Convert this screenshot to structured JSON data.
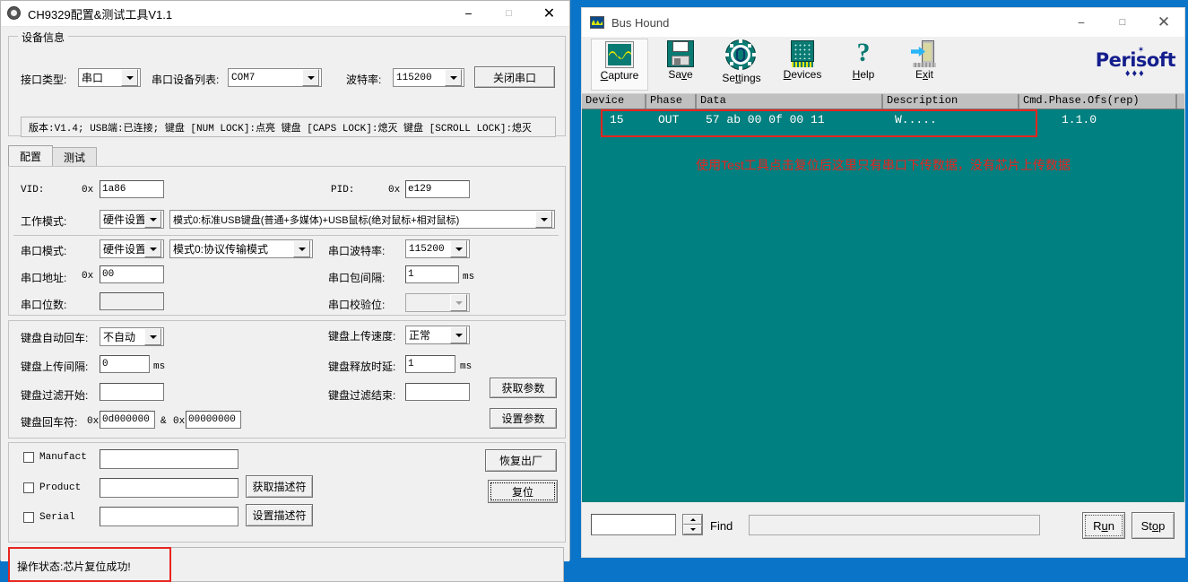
{
  "ch9329": {
    "title": "CH9329配置&测试工具V1.1",
    "titlebar": {
      "minimize": "−",
      "maximize": "□",
      "close": "✕"
    },
    "device_info": {
      "group_label": "设备信息",
      "interface_type_label": "接口类型:",
      "interface_type_value": "串口",
      "port_list_label": "串口设备列表:",
      "port_list_value": "COM7",
      "baud_label": "波特率:",
      "baud_value": "115200",
      "close_port_button": "关闭串口",
      "status_line": "版本:V1.4;  USB端:已连接;  键盘 [NUM LOCK]:点亮  键盘 [CAPS LOCK]:熄灭  键盘 [SCROLL LOCK]:熄灭"
    },
    "tabs": [
      {
        "label": "配置",
        "selected": true
      },
      {
        "label": "测试",
        "selected": false
      }
    ],
    "usb_section": {
      "vid_label": "VID:",
      "vid_prefix": "0x",
      "vid_value": "1a86",
      "pid_label": "PID:",
      "pid_prefix": "0x",
      "pid_value": "e129",
      "work_mode_label": "工作模式:",
      "work_mode_source": "硬件设置",
      "work_mode_value": "模式0:标准USB键盘(普通+多媒体)+USB鼠标(绝对鼠标+相对鼠标)"
    },
    "serial_section": {
      "serial_mode_label": "串口模式:",
      "serial_mode_source": "硬件设置",
      "serial_mode_value": "模式0:协议传输模式",
      "serial_baud_label": "串口波特率:",
      "serial_baud_value": "115200",
      "serial_addr_label": "串口地址:",
      "serial_addr_prefix": "0x",
      "serial_addr_value": "00",
      "packet_interval_label": "串口包间隔:",
      "packet_interval_value": "1",
      "packet_interval_unit": "ms",
      "serial_bits_label": "串口位数:",
      "serial_bits_value": "",
      "parity_label": "串口校验位:",
      "parity_value": ""
    },
    "keyboard_section": {
      "auto_enter_label": "键盘自动回车:",
      "auto_enter_value": "不自动",
      "upload_speed_label": "键盘上传速度:",
      "upload_speed_value": "正常",
      "upload_interval_label": "键盘上传间隔:",
      "upload_interval_value": "0",
      "upload_interval_unit": "ms",
      "release_delay_label": "键盘释放时延:",
      "release_delay_value": "1",
      "release_delay_unit": "ms",
      "filter_start_label": "键盘过滤开始:",
      "filter_start_value": "",
      "filter_end_label": "键盘过滤结束:",
      "filter_end_value": "",
      "enter_char_label": "键盘回车符:",
      "enter_char_prefix1": "0x",
      "enter_char_value1": "0d000000",
      "enter_char_amp": "&",
      "enter_char_prefix2": "0x",
      "enter_char_value2": "00000000",
      "get_params_button": "获取参数",
      "set_params_button": "设置参数"
    },
    "descriptor_section": {
      "manufact_label": "Manufact",
      "manufact_value": "",
      "product_label": "Product",
      "product_value": "",
      "serial_label": "Serial",
      "serial_value": "",
      "get_descriptor_button": "获取描述符",
      "set_descriptor_button": "设置描述符",
      "factory_reset_button": "恢复出厂",
      "reset_button": "复位"
    },
    "operation_status": "操作状态:芯片复位成功!"
  },
  "bushound": {
    "title": "Bus Hound",
    "titlebar": {
      "minimize": "−",
      "maximize": "□",
      "close": "✕"
    },
    "toolbar": [
      {
        "label_pre": "",
        "label_key": "C",
        "label_post": "apture",
        "icon": "oscilloscope-icon",
        "selected": true
      },
      {
        "label_pre": "Sa",
        "label_key": "v",
        "label_post": "e",
        "icon": "floppy-disk-icon",
        "selected": false
      },
      {
        "label_pre": "Se",
        "label_key": "tt",
        "label_post": "ings",
        "icon": "gear-icon",
        "selected": false
      },
      {
        "label_pre": "",
        "label_key": "D",
        "label_post": "evices",
        "icon": "chip-icon",
        "selected": false
      },
      {
        "label_pre": "",
        "label_key": "H",
        "label_post": "elp",
        "icon": "question-mark-icon",
        "selected": false
      },
      {
        "label_pre": "E",
        "label_key": "x",
        "label_post": "it",
        "icon": "exit-door-icon",
        "selected": false
      }
    ],
    "brand": {
      "name": "Perisoft",
      "star": "✶",
      "diamonds": "♦♦♦",
      "color": "#141e8c"
    },
    "grid": {
      "columns": [
        "Device",
        "Phase",
        "Data",
        "Description",
        "Cmd.Phase.Ofs(rep)"
      ],
      "rows": [
        {
          "device": "15",
          "phase": "OUT",
          "data": "57 ab 00 0f  00 11",
          "description": "W.....",
          "cmd": "1.1.0",
          "highlighted": true
        }
      ],
      "background_color": "#008080",
      "highlight_color": "#e8251f"
    },
    "annotation": "使用Test工具点击复位后这里只有串口下传数据，没有芯片上传数据",
    "bottom_bar": {
      "count_value": "",
      "spinner_up": "▲",
      "spinner_down": "▼",
      "find_label": "Find",
      "find_value": "",
      "run_button_pre": "R",
      "run_button_key": "u",
      "run_button_post": "n",
      "stop_button_pre": "St",
      "stop_button_key": "o",
      "stop_button_post": "p"
    }
  },
  "desktop": {
    "strip_text": ""
  }
}
